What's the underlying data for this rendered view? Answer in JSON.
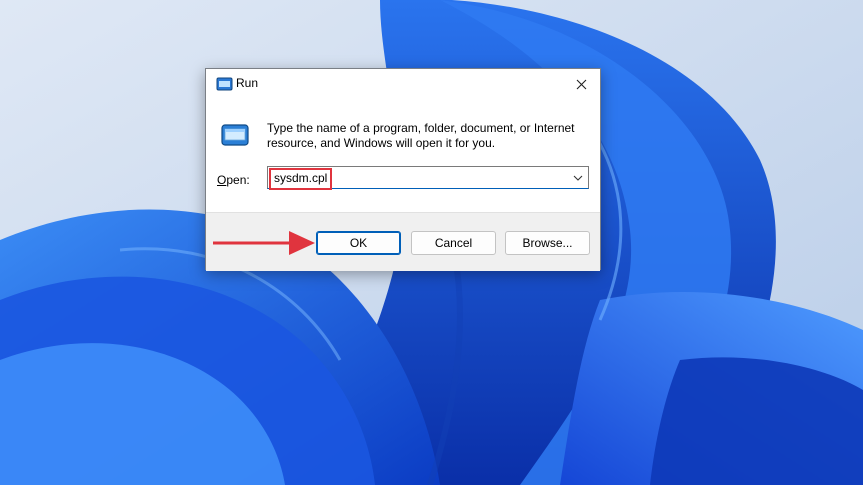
{
  "dialog": {
    "title": "Run",
    "description": "Type the name of a program, folder, document, or Internet resource, and Windows will open it for you.",
    "open_label_accesskey": "O",
    "open_label_rest": "pen:",
    "open_value": "sysdm.cpl",
    "buttons": {
      "ok": "OK",
      "cancel": "Cancel",
      "browse": "Browse..."
    }
  },
  "icons": {
    "title": "run-icon",
    "body": "run-icon",
    "close": "close-icon",
    "dropdown": "chevron-down-icon"
  },
  "colors": {
    "annotation": "#e0343e",
    "accent": "#005fb8",
    "wallpaper_blue": "#1f5fe0"
  }
}
